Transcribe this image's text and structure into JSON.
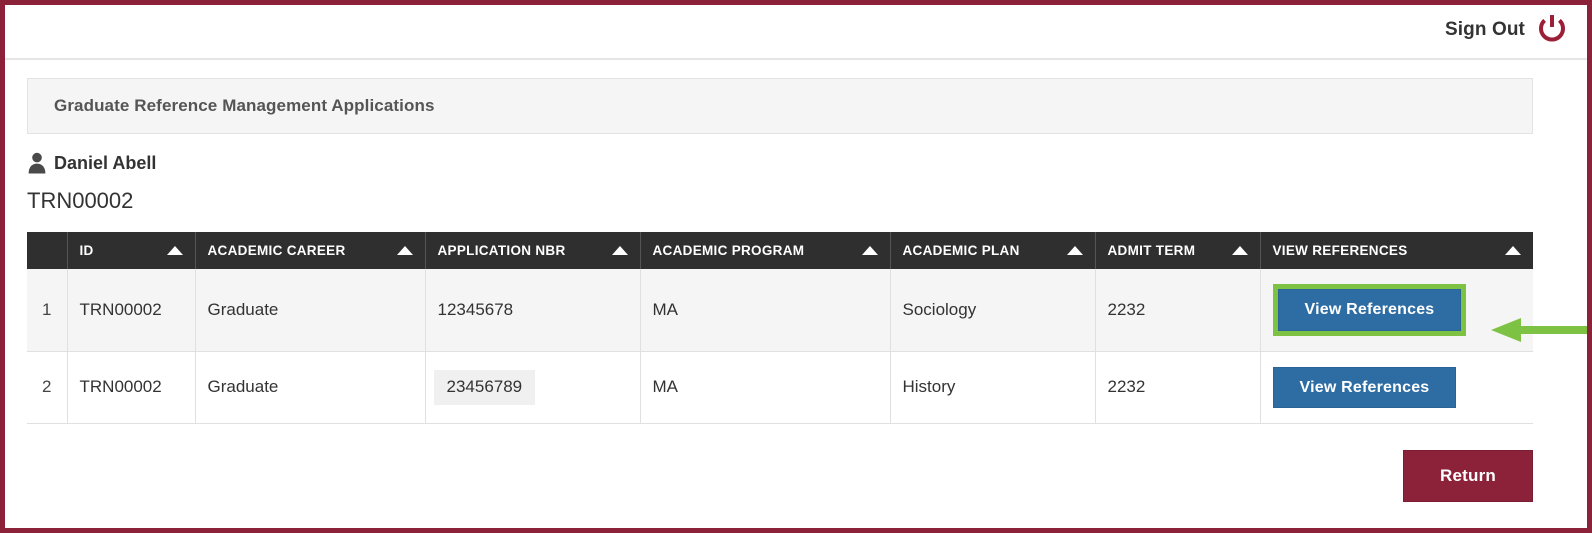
{
  "theme": {
    "frame_border": "#8b2239",
    "header_bg": "#2f2f2f",
    "button_blue": "#2e6da4",
    "button_maroon": "#8b2239",
    "highlight_green": "#7dc242",
    "row_alt_bg": "#f5f5f5"
  },
  "topbar": {
    "signout_label": "Sign Out",
    "signout_icon": "power-icon"
  },
  "panel": {
    "title": "Graduate Reference Management Applications"
  },
  "student": {
    "icon": "person-icon",
    "name": "Daniel Abell",
    "emplid": "TRN00002"
  },
  "table": {
    "sort_icon": "sort-ascending-caret",
    "columns": [
      {
        "key": "rownum",
        "label": ""
      },
      {
        "key": "id",
        "label": "ID"
      },
      {
        "key": "academic_career",
        "label": "ACADEMIC CAREER"
      },
      {
        "key": "application_nbr",
        "label": "APPLICATION NBR"
      },
      {
        "key": "academic_program",
        "label": "ACADEMIC PROGRAM"
      },
      {
        "key": "academic_plan",
        "label": "ACADEMIC PLAN"
      },
      {
        "key": "admit_term",
        "label": "ADMIT TERM"
      },
      {
        "key": "view_references",
        "label": "VIEW REFERENCES"
      }
    ],
    "rows": [
      {
        "rownum": "1",
        "id": "TRN00002",
        "academic_career": "Graduate",
        "application_nbr": "12345678",
        "academic_program": "MA",
        "academic_plan": "Sociology",
        "admit_term": "2232",
        "view_references": "View References"
      },
      {
        "rownum": "2",
        "id": "TRN00002",
        "academic_career": "Graduate",
        "application_nbr": "23456789",
        "academic_program": "MA",
        "academic_plan": "History",
        "admit_term": "2232",
        "view_references": "View References"
      }
    ]
  },
  "footer": {
    "return_label": "Return"
  },
  "annotation": {
    "type": "arrow-pointing-left",
    "color": "#7dc242",
    "target": "view-references-button-row-1"
  }
}
